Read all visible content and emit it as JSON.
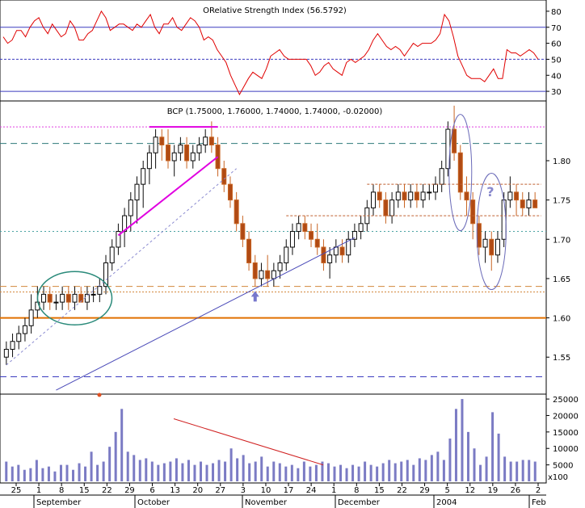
{
  "chart_data": [
    {
      "panel": "rsi",
      "type": "line",
      "title": "ORelative Strength Index (56.5792)",
      "ylim": [
        25,
        85
      ],
      "yticks": [
        30,
        40,
        50,
        60,
        70,
        80
      ],
      "reference_lines": [
        30,
        50,
        70
      ],
      "colors": {
        "line": "#e00000",
        "ref": "#3b3bbf"
      },
      "series": [
        {
          "values": [
            64,
            60,
            62,
            68,
            68,
            64,
            70,
            74,
            76,
            70,
            66,
            72,
            68,
            64,
            66,
            74,
            70,
            62,
            62,
            66,
            68,
            74,
            80,
            76,
            68,
            70,
            72,
            72,
            70,
            68,
            72,
            70,
            74,
            78,
            70,
            66,
            72,
            72,
            76,
            70,
            68,
            72,
            76,
            74,
            70,
            62,
            64,
            62,
            56,
            52,
            48,
            40,
            34,
            28,
            33,
            38,
            42,
            40,
            38,
            44,
            52,
            54,
            56,
            52,
            50,
            50,
            50,
            50,
            50,
            46,
            40,
            42,
            46,
            48,
            44,
            42,
            40,
            48,
            50,
            48,
            50,
            52,
            56,
            62,
            66,
            62,
            58,
            56,
            58,
            56,
            52,
            56,
            60,
            58,
            60,
            60,
            60,
            62,
            66,
            78,
            74,
            64,
            52,
            46,
            40,
            38,
            38,
            38,
            36,
            40,
            44,
            38,
            38,
            56,
            54,
            54,
            52,
            54,
            56,
            54,
            50
          ]
        }
      ]
    },
    {
      "panel": "price",
      "type": "ohlc",
      "title": "BCP (1.75000, 1.76000, 1.74000, 1.74000, -0.02000)",
      "ylim": [
        1.505,
        1.875
      ],
      "yticks": [
        1.55,
        1.6,
        1.65,
        1.7,
        1.75,
        1.8
      ],
      "colors": {
        "up": "#0a0a0a",
        "down": "#c86422",
        "fill_up": "#ffffff",
        "fill_down": "#b04a14"
      },
      "series": [
        {
          "name": "BCP",
          "values": [
            [
              1.55,
              1.57,
              1.54,
              1.56
            ],
            [
              1.56,
              1.58,
              1.55,
              1.57
            ],
            [
              1.57,
              1.59,
              1.56,
              1.58
            ],
            [
              1.58,
              1.6,
              1.57,
              1.59
            ],
            [
              1.59,
              1.63,
              1.58,
              1.61
            ],
            [
              1.61,
              1.64,
              1.6,
              1.62
            ],
            [
              1.62,
              1.64,
              1.61,
              1.63
            ],
            [
              1.63,
              1.64,
              1.61,
              1.62
            ],
            [
              1.62,
              1.63,
              1.61,
              1.62
            ],
            [
              1.62,
              1.64,
              1.61,
              1.63
            ],
            [
              1.63,
              1.64,
              1.61,
              1.62
            ],
            [
              1.62,
              1.64,
              1.61,
              1.63
            ],
            [
              1.63,
              1.64,
              1.62,
              1.62
            ],
            [
              1.62,
              1.64,
              1.61,
              1.63
            ],
            [
              1.63,
              1.64,
              1.62,
              1.63
            ],
            [
              1.63,
              1.65,
              1.62,
              1.64
            ],
            [
              1.64,
              1.68,
              1.63,
              1.67
            ],
            [
              1.67,
              1.7,
              1.66,
              1.69
            ],
            [
              1.69,
              1.72,
              1.68,
              1.71
            ],
            [
              1.71,
              1.74,
              1.69,
              1.73
            ],
            [
              1.73,
              1.76,
              1.71,
              1.75
            ],
            [
              1.75,
              1.78,
              1.72,
              1.77
            ],
            [
              1.77,
              1.8,
              1.74,
              1.79
            ],
            [
              1.79,
              1.82,
              1.77,
              1.81
            ],
            [
              1.81,
              1.84,
              1.79,
              1.83
            ],
            [
              1.83,
              1.84,
              1.8,
              1.82
            ],
            [
              1.82,
              1.84,
              1.79,
              1.8
            ],
            [
              1.8,
              1.82,
              1.78,
              1.81
            ],
            [
              1.81,
              1.83,
              1.8,
              1.82
            ],
            [
              1.82,
              1.83,
              1.79,
              1.8
            ],
            [
              1.8,
              1.82,
              1.79,
              1.81
            ],
            [
              1.81,
              1.83,
              1.8,
              1.82
            ],
            [
              1.82,
              1.84,
              1.81,
              1.83
            ],
            [
              1.83,
              1.85,
              1.81,
              1.82
            ],
            [
              1.82,
              1.83,
              1.78,
              1.79
            ],
            [
              1.79,
              1.8,
              1.76,
              1.77
            ],
            [
              1.77,
              1.78,
              1.74,
              1.75
            ],
            [
              1.75,
              1.76,
              1.71,
              1.72
            ],
            [
              1.72,
              1.73,
              1.69,
              1.7
            ],
            [
              1.7,
              1.71,
              1.66,
              1.67
            ],
            [
              1.67,
              1.68,
              1.64,
              1.65
            ],
            [
              1.65,
              1.67,
              1.64,
              1.66
            ],
            [
              1.66,
              1.68,
              1.64,
              1.65
            ],
            [
              1.65,
              1.67,
              1.64,
              1.66
            ],
            [
              1.66,
              1.68,
              1.65,
              1.67
            ],
            [
              1.67,
              1.7,
              1.66,
              1.69
            ],
            [
              1.69,
              1.72,
              1.68,
              1.71
            ],
            [
              1.71,
              1.73,
              1.7,
              1.72
            ],
            [
              1.72,
              1.73,
              1.7,
              1.71
            ],
            [
              1.71,
              1.72,
              1.69,
              1.7
            ],
            [
              1.7,
              1.72,
              1.68,
              1.69
            ],
            [
              1.69,
              1.7,
              1.66,
              1.67
            ],
            [
              1.67,
              1.69,
              1.65,
              1.68
            ],
            [
              1.68,
              1.7,
              1.67,
              1.69
            ],
            [
              1.69,
              1.7,
              1.67,
              1.68
            ],
            [
              1.68,
              1.71,
              1.67,
              1.7
            ],
            [
              1.7,
              1.72,
              1.69,
              1.71
            ],
            [
              1.71,
              1.73,
              1.7,
              1.72
            ],
            [
              1.72,
              1.75,
              1.71,
              1.74
            ],
            [
              1.74,
              1.77,
              1.73,
              1.76
            ],
            [
              1.76,
              1.77,
              1.74,
              1.75
            ],
            [
              1.75,
              1.76,
              1.72,
              1.73
            ],
            [
              1.73,
              1.76,
              1.72,
              1.75
            ],
            [
              1.75,
              1.77,
              1.74,
              1.76
            ],
            [
              1.76,
              1.77,
              1.74,
              1.75
            ],
            [
              1.75,
              1.77,
              1.74,
              1.76
            ],
            [
              1.76,
              1.77,
              1.74,
              1.75
            ],
            [
              1.75,
              1.77,
              1.74,
              1.76
            ],
            [
              1.76,
              1.77,
              1.75,
              1.76
            ],
            [
              1.76,
              1.78,
              1.75,
              1.77
            ],
            [
              1.77,
              1.8,
              1.76,
              1.79
            ],
            [
              1.79,
              1.85,
              1.78,
              1.84
            ],
            [
              1.84,
              1.87,
              1.8,
              1.81
            ],
            [
              1.81,
              1.82,
              1.75,
              1.76
            ],
            [
              1.76,
              1.78,
              1.73,
              1.75
            ],
            [
              1.75,
              1.76,
              1.7,
              1.72
            ],
            [
              1.72,
              1.73,
              1.68,
              1.69
            ],
            [
              1.69,
              1.71,
              1.67,
              1.7
            ],
            [
              1.7,
              1.71,
              1.66,
              1.68
            ],
            [
              1.68,
              1.71,
              1.67,
              1.7
            ],
            [
              1.7,
              1.76,
              1.69,
              1.75
            ],
            [
              1.75,
              1.78,
              1.74,
              1.76
            ],
            [
              1.76,
              1.77,
              1.73,
              1.75
            ],
            [
              1.75,
              1.76,
              1.73,
              1.74
            ],
            [
              1.74,
              1.76,
              1.73,
              1.75
            ],
            [
              1.75,
              1.76,
              1.74,
              1.74
            ]
          ]
        }
      ],
      "reference_lines": [
        1.843,
        1.822,
        1.71,
        1.64,
        1.633,
        1.6,
        1.525
      ]
    },
    {
      "panel": "volume",
      "type": "bar",
      "ylim": [
        0,
        26000
      ],
      "yticks": [
        5000,
        10000,
        15000,
        20000,
        25000
      ],
      "colors": {
        "bar": "#7b7bc4",
        "trend": "#d02020"
      },
      "series": [
        {
          "values": [
            6000,
            4500,
            5000,
            3500,
            4000,
            6500,
            4000,
            4500,
            3000,
            5000,
            5000,
            3500,
            5500,
            4500,
            9000,
            5000,
            6000,
            10500,
            15000,
            22000,
            9000,
            8000,
            6500,
            7000,
            6000,
            5000,
            5500,
            6000,
            7000,
            5500,
            6500,
            5000,
            6000,
            5000,
            5500,
            6500,
            6000,
            10000,
            7000,
            8000,
            5500,
            6000,
            7500,
            4500,
            6000,
            5500,
            4500,
            5000,
            4000,
            6000,
            4500,
            5000,
            6000,
            5500,
            4500,
            5000,
            4000,
            5000,
            4500,
            6000,
            5000,
            4500,
            5500,
            6500,
            5500,
            6000,
            6500,
            5000,
            7000,
            6500,
            8000,
            9000,
            6500,
            13000,
            22000,
            25000,
            15000,
            10000,
            5000,
            7500,
            21000,
            14500,
            7500,
            6000,
            6000,
            6500,
            6500,
            6000
          ]
        }
      ]
    }
  ],
  "x_axis": {
    "day_labels": [
      "25",
      "1",
      "8",
      "15",
      "22",
      "29",
      "6",
      "13",
      "20",
      "27",
      "3",
      "10",
      "17",
      "24",
      "1",
      "8",
      "15",
      "22",
      "29",
      "5",
      "12",
      "19",
      "26",
      "2"
    ],
    "month_labels": [
      "September",
      "October",
      "November",
      "December",
      "2004",
      "Feb"
    ]
  }
}
